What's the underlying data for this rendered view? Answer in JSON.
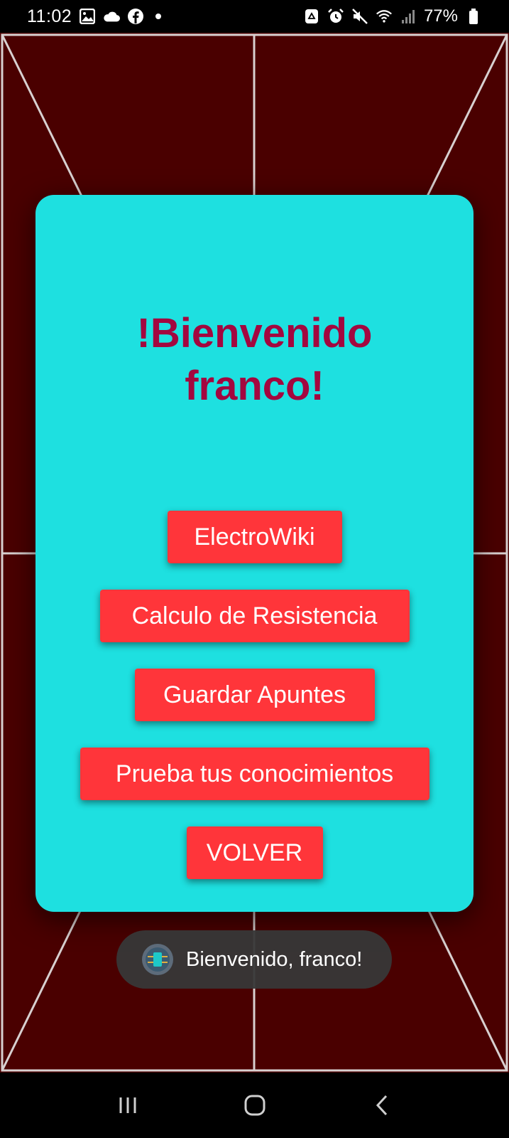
{
  "status_bar": {
    "time": "11:02",
    "left_icons": [
      "gallery-icon",
      "cloud-icon",
      "facebook-icon",
      "notification-dot-icon"
    ],
    "right_icons": [
      "recycle-icon",
      "alarm-icon",
      "mute-icon",
      "wifi-icon",
      "signal-icon"
    ],
    "battery_percent": "77%"
  },
  "dialog": {
    "welcome_text": "!Bienvenido\nfranco!",
    "buttons": [
      "ElectroWiki",
      "Calculo de Resistencia",
      "Guardar Apuntes",
      "Prueba tus conocimientos",
      "VOLVER"
    ]
  },
  "toast": {
    "message": "Bienvenido, franco!",
    "icon": "app-logo-icon"
  },
  "navigation_bar": {
    "buttons": [
      "recent-apps-icon",
      "home-icon",
      "back-icon"
    ]
  },
  "colors": {
    "background": "#4a0000",
    "card": "#1ee0e0",
    "title": "#a3073f",
    "button": "#ff353a",
    "toast": "#373737"
  }
}
